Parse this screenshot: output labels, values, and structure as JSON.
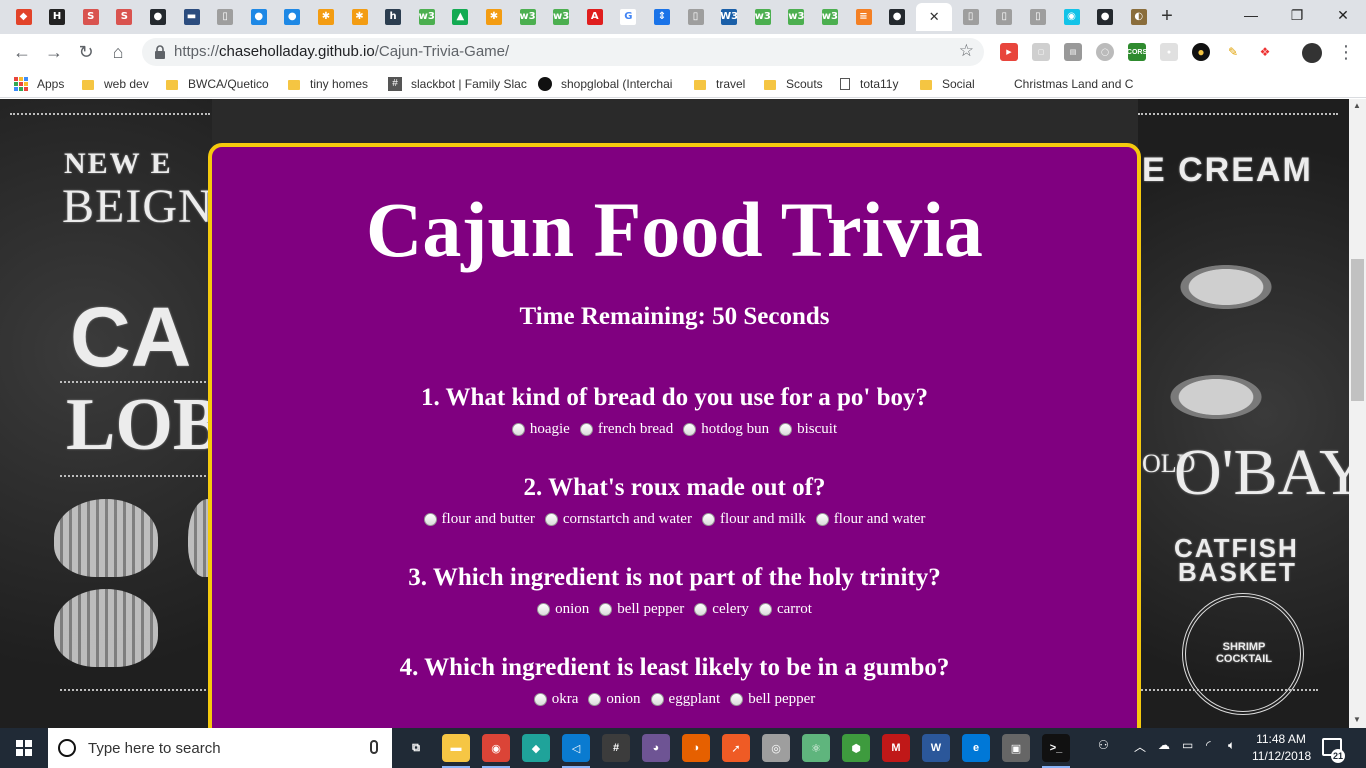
{
  "browser": {
    "tabs": [
      {
        "icon": "gitlab-icon",
        "color": "#e24329",
        "glyph": "◆"
      },
      {
        "icon": "hashnode-icon",
        "color": "#222222",
        "glyph": "H"
      },
      {
        "icon": "scribd-icon",
        "color": "#d9534f",
        "glyph": "S"
      },
      {
        "icon": "scribd-icon",
        "color": "#d9534f",
        "glyph": "S"
      },
      {
        "icon": "github-icon",
        "color": "#24292e",
        "glyph": "●"
      },
      {
        "icon": "flag-icon",
        "color": "#2b4c7e",
        "glyph": "▬"
      },
      {
        "icon": "page-icon",
        "color": "#9e9e9e",
        "glyph": "▯"
      },
      {
        "icon": "drop-icon",
        "color": "#1e88e5",
        "glyph": "●"
      },
      {
        "icon": "drop-icon",
        "color": "#1e88e5",
        "glyph": "●"
      },
      {
        "icon": "asterisk-icon",
        "color": "#f39c12",
        "glyph": "✱"
      },
      {
        "icon": "asterisk-icon",
        "color": "#f39c12",
        "glyph": "✱"
      },
      {
        "icon": "hackerrank-icon",
        "color": "#2c3e50",
        "glyph": "h"
      },
      {
        "icon": "w3schools-icon",
        "color": "#4caf50",
        "glyph": "w3"
      },
      {
        "icon": "mongodb-icon",
        "color": "#13aa52",
        "glyph": "▲"
      },
      {
        "icon": "asterisk-icon",
        "color": "#f39c12",
        "glyph": "✱"
      },
      {
        "icon": "w3schools-icon",
        "color": "#4caf50",
        "glyph": "w3"
      },
      {
        "icon": "w3schools-icon",
        "color": "#4caf50",
        "glyph": "w3"
      },
      {
        "icon": "adobe-icon",
        "color": "#e01e1e",
        "glyph": "A"
      },
      {
        "icon": "google-icon",
        "color": "#ffffff",
        "glyph": "G"
      },
      {
        "icon": "arrows-icon",
        "color": "#1a73e8",
        "glyph": "⇕"
      },
      {
        "icon": "page-icon",
        "color": "#9e9e9e",
        "glyph": "▯"
      },
      {
        "icon": "w3c-icon",
        "color": "#1a5fa8",
        "glyph": "W3"
      },
      {
        "icon": "w3schools-icon",
        "color": "#4caf50",
        "glyph": "w3"
      },
      {
        "icon": "w3schools-icon",
        "color": "#4caf50",
        "glyph": "w3"
      },
      {
        "icon": "w3schools-icon",
        "color": "#4caf50",
        "glyph": "w3"
      },
      {
        "icon": "stackoverflow-icon",
        "color": "#f48024",
        "glyph": "≡"
      },
      {
        "icon": "github-icon",
        "color": "#24292e",
        "glyph": "●"
      }
    ],
    "tabs_after": [
      {
        "icon": "page-icon",
        "color": "#9e9e9e",
        "glyph": "▯"
      },
      {
        "icon": "page-icon",
        "color": "#9e9e9e",
        "glyph": "▯"
      },
      {
        "icon": "page-icon",
        "color": "#9e9e9e",
        "glyph": "▯"
      },
      {
        "icon": "codepen-icon",
        "color": "#12c3e8",
        "glyph": "◉"
      },
      {
        "icon": "github-icon",
        "color": "#24292e",
        "glyph": "●"
      },
      {
        "icon": "gimp-icon",
        "color": "#8a6d3b",
        "glyph": "◐"
      }
    ],
    "active_tab_close": "✕",
    "new_tab": "+",
    "window_controls": {
      "minimize": "—",
      "maximize": "❐",
      "close": "✕"
    },
    "url_prefix": "https://",
    "url_host": "chaseholladay.github.io",
    "url_path": "/Cajun-Trivia-Game/"
  },
  "bookmarks": [
    {
      "type": "apps",
      "label": "Apps"
    },
    {
      "type": "folder",
      "label": "web dev"
    },
    {
      "type": "folder",
      "label": "BWCA/Quetico"
    },
    {
      "type": "folder",
      "label": "tiny homes"
    },
    {
      "type": "hash",
      "label": "slackbot | Family Slac"
    },
    {
      "type": "github",
      "label": "shopglobal (Interchai"
    },
    {
      "type": "folder",
      "label": "travel"
    },
    {
      "type": "folder",
      "label": "Scouts"
    },
    {
      "type": "page",
      "label": "tota11y"
    },
    {
      "type": "folder",
      "label": "Social"
    },
    {
      "type": "none",
      "label": "Christmas Land and C"
    }
  ],
  "background": {
    "left": {
      "line1": "NEW E",
      "line2": "BEIGNET",
      "line3": "CA",
      "line4": "LOBS"
    },
    "right": {
      "line1": "E CREAM",
      "line2": "OLD",
      "line3": "O'BAY",
      "line4": "CATFISH",
      "line5": "BASKET",
      "badge": "SHRIMP COCKTAIL"
    }
  },
  "game": {
    "title": "Cajun Food Trivia",
    "timer_label": "Time Remaining:",
    "timer_value": "50",
    "timer_unit": "Seconds",
    "questions": [
      {
        "number": "1.",
        "text": "What kind of bread do you use for a po' boy?",
        "options": [
          "hoagie",
          "french bread",
          "hotdog bun",
          "biscuit"
        ]
      },
      {
        "number": "2.",
        "text": "What's roux made out of?",
        "options": [
          "flour and butter",
          "cornstartch and water",
          "flour and milk",
          "flour and water"
        ]
      },
      {
        "number": "3.",
        "text": "Which ingredient is not part of the holy trinity?",
        "options": [
          "onion",
          "bell pepper",
          "celery",
          "carrot"
        ]
      },
      {
        "number": "4.",
        "text": "Which ingredient is least likely to be in a gumbo?",
        "options": [
          "okra",
          "onion",
          "eggplant",
          "bell pepper"
        ]
      }
    ],
    "colors": {
      "card": "#800080",
      "border": "#f5c90d",
      "text": "#ffffff"
    }
  },
  "taskbar": {
    "search_placeholder": "Type here to search",
    "apps": [
      {
        "name": "task-view-icon",
        "color": "transparent",
        "glyph": "⧉"
      },
      {
        "name": "file-explorer-icon",
        "color": "#f6c644",
        "glyph": "▬"
      },
      {
        "name": "chrome-icon",
        "color": "#db4437",
        "glyph": "◉"
      },
      {
        "name": "gitkraken-icon",
        "color": "#1fa39a",
        "glyph": "◆"
      },
      {
        "name": "vscode-icon",
        "color": "#0a7bd0",
        "glyph": "◁"
      },
      {
        "name": "slack-icon",
        "color": "#3c3c3c",
        "glyph": "#"
      },
      {
        "name": "github-desktop-icon",
        "color": "#6e5494",
        "glyph": "◕"
      },
      {
        "name": "firefox-icon",
        "color": "#e66000",
        "glyph": "◑"
      },
      {
        "name": "postman-icon",
        "color": "#ef5b25",
        "glyph": "➚"
      },
      {
        "name": "app-icon",
        "color": "#9e9e9e",
        "glyph": "◎"
      },
      {
        "name": "atom-icon",
        "color": "#5fb57d",
        "glyph": "⚛"
      },
      {
        "name": "app-green-icon",
        "color": "#3e9b3e",
        "glyph": "⬢"
      },
      {
        "name": "mcafee-icon",
        "color": "#c01818",
        "glyph": "M"
      },
      {
        "name": "word-icon",
        "color": "#2b579a",
        "glyph": "W"
      },
      {
        "name": "edge-icon",
        "color": "#0078d7",
        "glyph": "e"
      },
      {
        "name": "app-box-icon",
        "color": "#666666",
        "glyph": "▣"
      },
      {
        "name": "terminal-icon",
        "color": "#111111",
        "glyph": ">_"
      }
    ],
    "time": "11:48 AM",
    "date": "11/12/2018",
    "notification_count": "21"
  }
}
